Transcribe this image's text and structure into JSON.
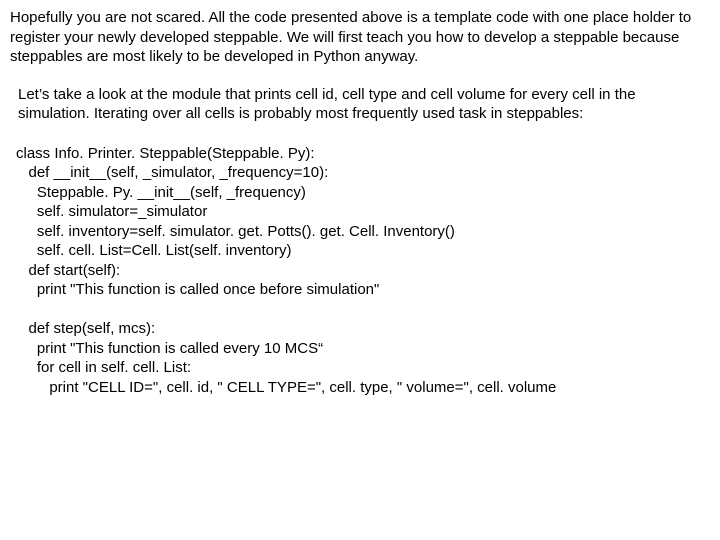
{
  "para1": "Hopefully you are not scared. All the code presented above is a template code with one place holder to register your newly developed steppable. We will first teach you how to develop a steppable because steppables are most likely to be developed in Python anyway.",
  "para2": "Let’s take a look at the module that prints cell id, cell type and cell volume for every cell in the simulation. Iterating over all cells is probably most frequently used task in steppables:",
  "code": "class Info. Printer. Steppable(Steppable. Py):\n   def __init__(self, _simulator, _frequency=10):\n     Steppable. Py. __init__(self, _frequency)\n     self. simulator=_simulator\n     self. inventory=self. simulator. get. Potts(). get. Cell. Inventory()\n     self. cell. List=Cell. List(self. inventory)\n   def start(self):\n     print \"This function is called once before simulation\"\n\n   def step(self, mcs):\n     print \"This function is called every 10 MCS“\n     for cell in self. cell. List:\n        print \"CELL ID=\", cell. id, \" CELL TYPE=\", cell. type, \" volume=\", cell. volume"
}
